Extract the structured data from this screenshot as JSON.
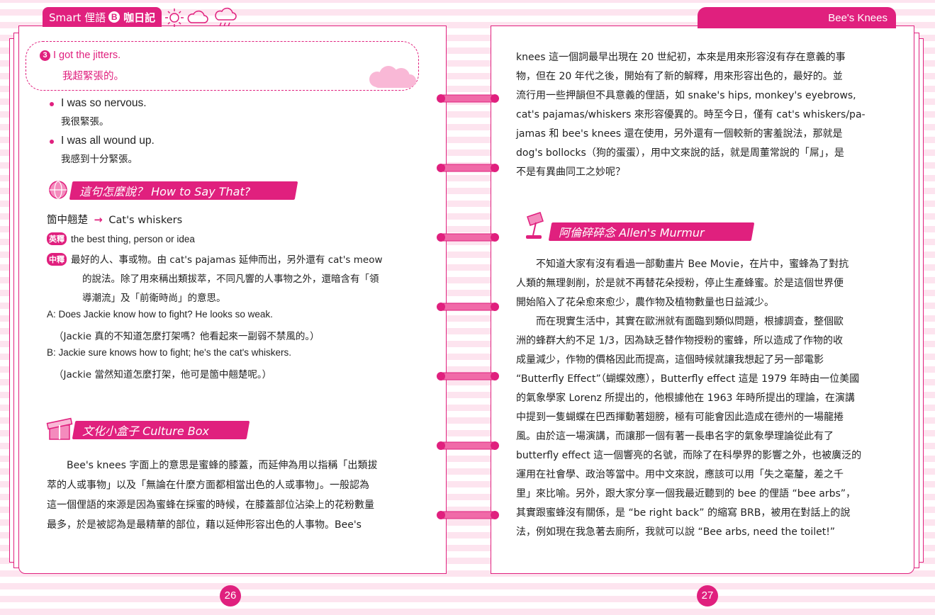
{
  "header": {
    "left_title_prefix": "Smart 俚語",
    "left_badge": "B",
    "left_title_suffix": "咖日記",
    "right_title": "Bee's Knees"
  },
  "left": {
    "phrase": {
      "number": "3",
      "en": "I got the jitters.",
      "zh": "我超緊張的。"
    },
    "alternatives": [
      {
        "en": "I was so nervous.",
        "zh": "我很緊張。"
      },
      {
        "en": "I was all wound up.",
        "zh": "我感到十分緊張。"
      }
    ],
    "how_to_say": {
      "title": "這句怎麼說？ How to Say That?",
      "term_zh": "箇中翹楚",
      "arrow": "→",
      "term_en": "Cat's whiskers",
      "tag_en": "英釋",
      "def_en": "the best thing, person or idea",
      "tag_zh": "中釋",
      "def_zh_lines": [
        "最好的人、事或物。由 cat's pajamas 延伸而出，另外還有 cat's meow",
        "的說法。除了用來稱出類拔萃，不同凡響的人事物之外，還暗含有「領",
        "導潮流」及「前衛時尚」的意思。"
      ],
      "example_a_en": "A: Does Jackie know how to fight? He looks so weak.",
      "example_a_zh": "（Jackie 真的不知道怎麼打架嗎？他看起來一副弱不禁風的。）",
      "example_b_en": "B: Jackie sure knows how to fight; he's the cat's whiskers.",
      "example_b_zh": "（Jackie 當然知道怎麼打架，他可是箇中翹楚呢。）"
    },
    "culture_box": {
      "title": "文化小盒子 Culture Box",
      "lines": [
        "　　Bee's knees 字面上的意思是蜜蜂的膝蓋，而延伸為用以指稱「出類拔",
        "萃的人或事物」以及「無論在什麼方面都相當出色的人或事物」。一般認為",
        "這一個俚語的來源是因為蜜蜂在採蜜的時候，在膝蓋部位沾染上的花粉數量",
        "最多，於是被認為是最精華的部位，藉以延伸形容出色的人事物。Bee's"
      ]
    },
    "page_number": "26"
  },
  "right": {
    "continued_lines": [
      "knees 這一個詞最早出現在 20 世紀初，本來是用來形容沒有存在意義的事",
      "物，但在 20 年代之後，開始有了新的解釋，用來形容出色的，最好的。並",
      "流行用一些押韻但不具意義的俚語，如 snake's hips, monkey's eyebrows,",
      "cat's pajamas/whiskers 來形容優異的。時至今日，僅有 cat's whiskers/pa-",
      "jamas 和 bee's knees 還在使用，另外還有一個較新的害羞說法，那就是",
      "dog's bollocks（狗的蛋蛋），用中文來說的話，就是周董常說的「屌」，是",
      "不是有異曲同工之妙呢？"
    ],
    "murmur": {
      "title": "阿倫碎碎念 Allen's Murmur",
      "lines": [
        "　　不知道大家有沒有看過一部動畫片 Bee Movie，在片中，蜜蜂為了對抗",
        "人類的無理剝削，於是就不再替花朵授粉，停止生產蜂蜜。於是這個世界便",
        "開始陷入了花朵愈來愈少，農作物及植物數量也日益減少。",
        "　　而在現實生活中，其實在歐洲就有面臨到類似問題，根據調查，整個歐",
        "洲的蜂群大約不足 1/3，因為缺乏替作物授粉的蜜蜂，所以造成了作物的收",
        "成量減少，作物的價格因此而提高，這個時候就讓我想起了另一部電影",
        "“Butterfly Effect”（蝴蝶效應），Butterfly effect 這是 1979 年時由一位美國",
        "的氣象學家 Lorenz 所提出的，他根據他在 1963 年時所提出的理論，在演講",
        "中提到一隻蝴蝶在巴西揮動著翅膀，極有可能會因此造成在德州的一場龍捲",
        "風。由於這一場演講，而讓那一個有著一長串名字的氣象學理論從此有了",
        "butterfly effect 這一個響亮的名號，而除了在科學界的影響之外，也被廣泛的",
        "運用在社會學、政治等當中。用中文來說，應該可以用「失之毫釐，差之千",
        "里」來比喻。另外，跟大家分享一個我最近聽到的 bee 的俚語 “bee arbs”，",
        "其實跟蜜蜂沒有關係，是 “be right back” 的縮寫 BRB，被用在對話上的說",
        "法，例如現在我急著去廁所，我就可以說 “Bee arbs, need the toilet!”"
      ]
    },
    "page_number": "27"
  },
  "colors": {
    "accent": "#e0207e",
    "stripe": "#fde4ef"
  },
  "icons": [
    "sun-icon",
    "cloud-icon",
    "rain-cloud-icon",
    "globe-icon",
    "gift-box-icon",
    "desk-lamp-icon",
    "binder-ring-icon"
  ]
}
